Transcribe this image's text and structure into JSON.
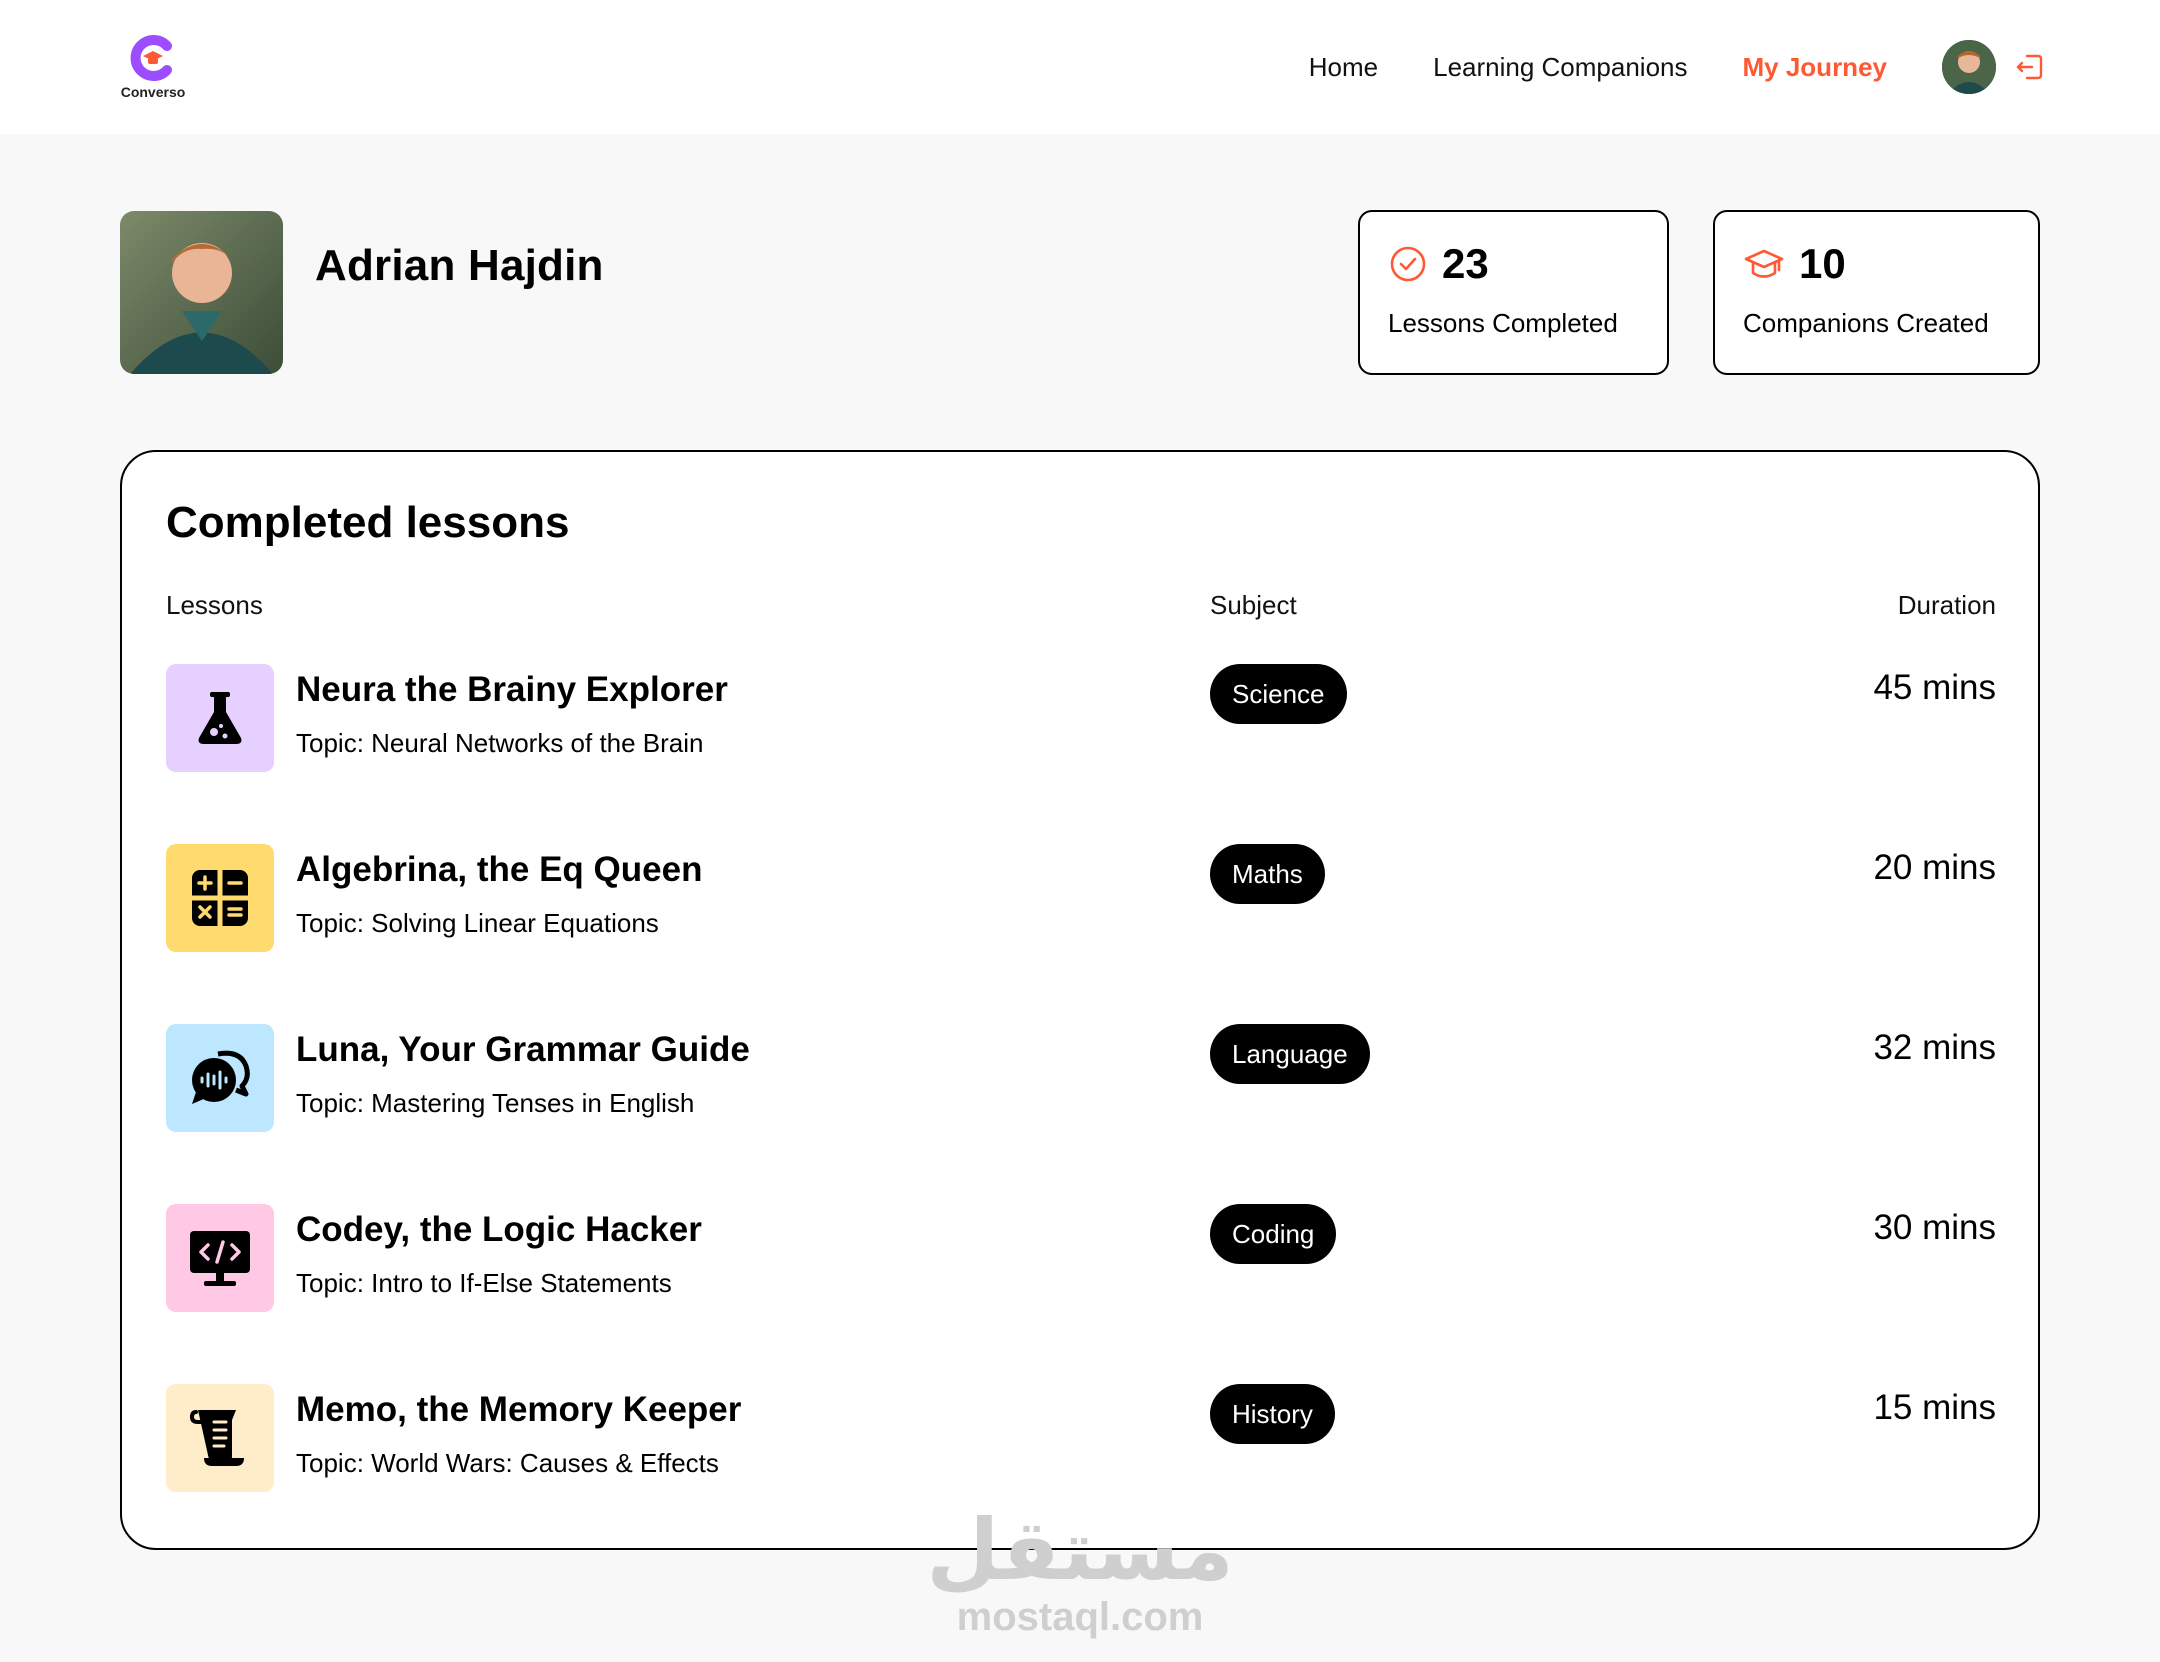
{
  "brand": {
    "name": "Converso"
  },
  "nav": {
    "links": [
      {
        "label": "Home",
        "active": false
      },
      {
        "label": "Learning Companions",
        "active": false
      },
      {
        "label": "My Journey",
        "active": true
      }
    ]
  },
  "profile": {
    "name": "Adrian Hajdin"
  },
  "stats": [
    {
      "value": "23",
      "label": "Lessons Completed",
      "icon": "check-circle-icon"
    },
    {
      "value": "10",
      "label": "Companions Created",
      "icon": "graduation-cap-icon"
    }
  ],
  "lessons_panel": {
    "title": "Completed lessons",
    "columns": {
      "lessons": "Lessons",
      "subject": "Subject",
      "duration": "Duration"
    },
    "rows": [
      {
        "name": "Neura the Brainy Explorer",
        "topic": "Topic: Neural Networks of the Brain",
        "subject": "Science",
        "duration": "45 mins",
        "icon": "flask-icon",
        "color": "#e5d0ff"
      },
      {
        "name": "Algebrina, the Eq Queen",
        "topic": "Topic: Solving Linear Equations",
        "subject": "Maths",
        "duration": "20 mins",
        "icon": "calculator-icon",
        "color": "#ffda6e"
      },
      {
        "name": "Luna, Your Grammar Guide",
        "topic": "Topic: Mastering Tenses in English",
        "subject": "Language",
        "duration": "32 mins",
        "icon": "speech-bubbles-icon",
        "color": "#bde7ff"
      },
      {
        "name": "Codey, the Logic Hacker",
        "topic": "Topic: Intro to If-Else Statements",
        "subject": "Coding",
        "duration": "30 mins",
        "icon": "code-monitor-icon",
        "color": "#ffc8e4"
      },
      {
        "name": "Memo, the Memory Keeper",
        "topic": "Topic: World Wars: Causes & Effects",
        "subject": "History",
        "duration": "15 mins",
        "icon": "scroll-icon",
        "color": "#ffecc8"
      }
    ]
  },
  "colors": {
    "accent": "#fe5933",
    "logo": "#9b4dff"
  },
  "watermark": {
    "arabic": "مستقل",
    "latin": "mostaql.com"
  }
}
